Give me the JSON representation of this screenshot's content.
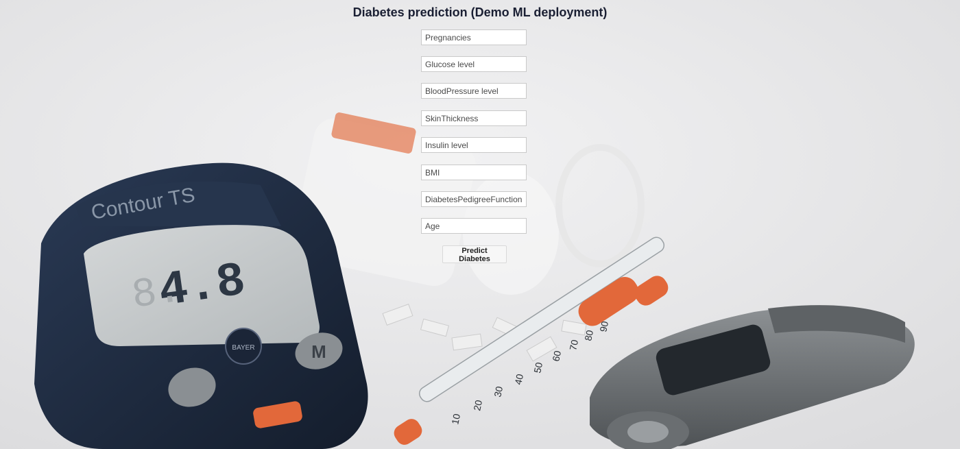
{
  "page": {
    "title": "Diabetes prediction (Demo ML deployment)"
  },
  "form": {
    "fields": [
      {
        "name": "Pregnancies",
        "placeholder": "Pregnancies",
        "value": ""
      },
      {
        "name": "Glucose",
        "placeholder": "Glucose level",
        "value": ""
      },
      {
        "name": "BloodPressure",
        "placeholder": "BloodPressure level",
        "value": ""
      },
      {
        "name": "SkinThickness",
        "placeholder": "SkinThickness",
        "value": ""
      },
      {
        "name": "Insulin",
        "placeholder": "Insulin level",
        "value": ""
      },
      {
        "name": "BMI",
        "placeholder": "BMI",
        "value": ""
      },
      {
        "name": "DiabetesPedigreeFunction",
        "placeholder": "DiabetesPedigreeFunction",
        "value": ""
      },
      {
        "name": "Age",
        "placeholder": "Age",
        "value": ""
      }
    ],
    "submit_label": "Predict Diabetes"
  },
  "background": {
    "meter_brand": "Contour TS",
    "meter_reading": "4.8",
    "meter_logo": "BAYER",
    "meter_button": "M",
    "syringe_scale": [
      "10",
      "20",
      "30",
      "40",
      "50",
      "60",
      "70",
      "80",
      "90"
    ],
    "colors": {
      "meter_body": "#1d2a3f",
      "meter_screen": "#c7cbcc",
      "accent_orange": "#e2683a",
      "button_grey": "#8a8f93",
      "lancet_body": "#6e7275"
    }
  }
}
